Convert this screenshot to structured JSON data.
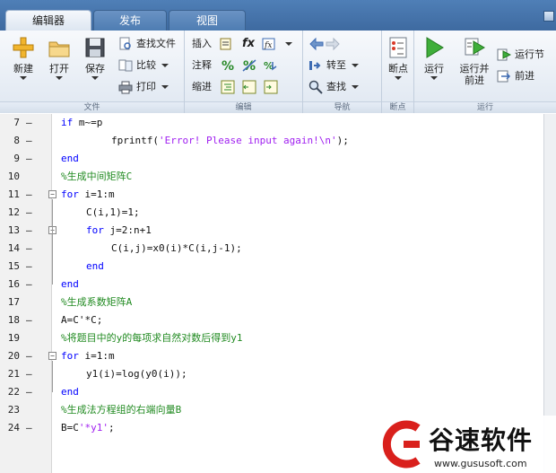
{
  "tabs": [
    "编辑器",
    "发布",
    "视图"
  ],
  "ribbon": {
    "file": {
      "label": "文件",
      "new": "新建",
      "open": "打开",
      "save": "保存",
      "find_files": "查找文件",
      "compare": "比较",
      "print": "打印"
    },
    "edit": {
      "label": "编辑",
      "insert": "插入",
      "comment": "注释",
      "indent": "缩进",
      "fx": "fx"
    },
    "navigate": {
      "label": "导航",
      "goto": "转至",
      "find": "查找"
    },
    "breakpoints": {
      "label": "断点",
      "breakpoint": "断点"
    },
    "run": {
      "label": "运行",
      "run": "运行",
      "run_advance": "运行并\n前进",
      "run_section": "运行节",
      "advance": "前进"
    }
  },
  "code_lines": [
    {
      "n": "7",
      "dash": "–",
      "text": "if m~=p"
    },
    {
      "n": "8",
      "dash": "–",
      "text": "fprintf('Error! Please input again!\\n');"
    },
    {
      "n": "9",
      "dash": "–",
      "text": "end"
    },
    {
      "n": "10",
      "dash": "",
      "text": "%生成中间矩阵C"
    },
    {
      "n": "11",
      "dash": "–",
      "text": "for i=1:m"
    },
    {
      "n": "12",
      "dash": "–",
      "text": "C(i,1)=1;"
    },
    {
      "n": "13",
      "dash": "–",
      "text": "for j=2:n+1"
    },
    {
      "n": "14",
      "dash": "–",
      "text": "C(i,j)=x0(i)*C(i,j-1);"
    },
    {
      "n": "15",
      "dash": "–",
      "text": "end"
    },
    {
      "n": "16",
      "dash": "–",
      "text": "end"
    },
    {
      "n": "17",
      "dash": "",
      "text": "%生成系数矩阵A"
    },
    {
      "n": "18",
      "dash": "–",
      "text": "A=C'*C;"
    },
    {
      "n": "19",
      "dash": "",
      "text": "%将题目中的y的每项求自然对数后得到y1"
    },
    {
      "n": "20",
      "dash": "–",
      "text": "for i=1:m"
    },
    {
      "n": "21",
      "dash": "–",
      "text": "y1(i)=log(y0(i));"
    },
    {
      "n": "22",
      "dash": "–",
      "text": "end"
    },
    {
      "n": "23",
      "dash": "",
      "text": "%生成法方程组的右端向量B"
    },
    {
      "n": "24",
      "dash": "–",
      "text": "B=C'*y1';"
    }
  ],
  "watermark": {
    "name": "谷速软件",
    "url": "www.gususoft.com"
  },
  "colors": {
    "keyword": "#0000ff",
    "comment": "#228b22",
    "string": "#a020f0",
    "watermark_red": "#d9201c"
  }
}
